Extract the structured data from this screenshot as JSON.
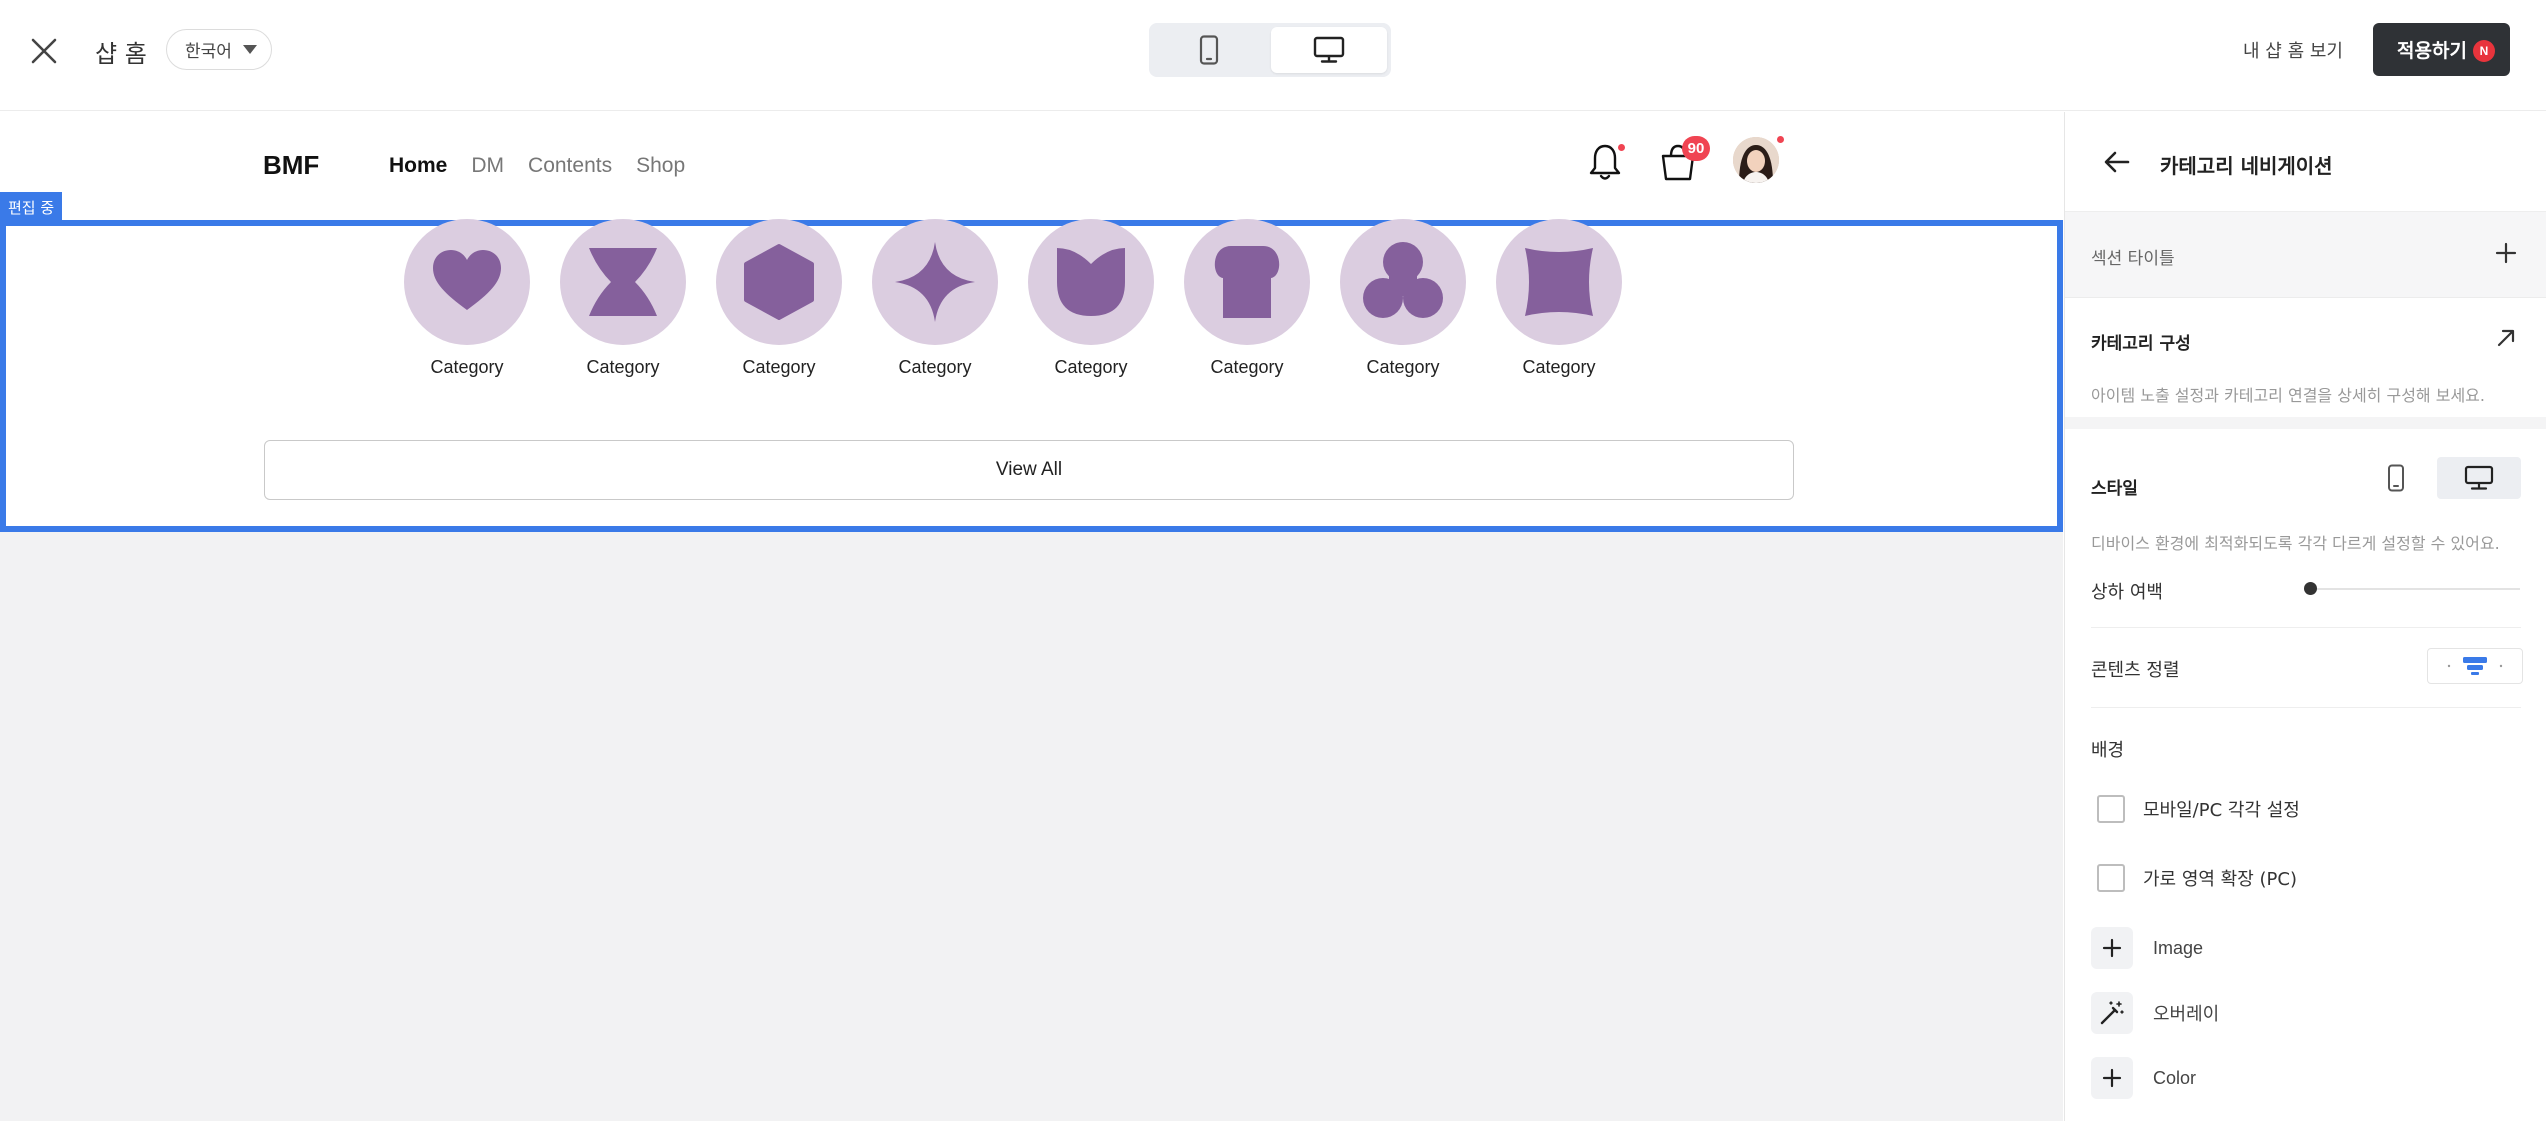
{
  "topbar": {
    "shop_home": "샵 홈",
    "language": "한국어",
    "view_my_shop": "내 샵 홈 보기",
    "apply": "적용하기",
    "apply_badge": "N"
  },
  "preview": {
    "brand": "BMF",
    "nav": [
      "Home",
      "DM",
      "Contents",
      "Shop"
    ],
    "cart_count": "90",
    "edit_tag": "편집 중",
    "categories": [
      {
        "label": "Category",
        "icon": "heart-shape"
      },
      {
        "label": "Category",
        "icon": "hourglass-shape"
      },
      {
        "label": "Category",
        "icon": "hexagon-shape"
      },
      {
        "label": "Category",
        "icon": "four-point-star-shape"
      },
      {
        "label": "Category",
        "icon": "tulip-shape"
      },
      {
        "label": "Category",
        "icon": "bread-shape"
      },
      {
        "label": "Category",
        "icon": "clover-shape"
      },
      {
        "label": "Category",
        "icon": "squircle-shape"
      }
    ],
    "view_all": "View All",
    "colors": {
      "category_bg": "#dbcde0",
      "category_fg": "#85609c",
      "edit_border": "#3a7ae8"
    }
  },
  "panel": {
    "title": "카테고리 네비게이션",
    "section_title": "섹션 타이틀",
    "category_compose": "카테고리 구성",
    "category_compose_desc": "아이템 노출 설정과 카테고리 연결을 상세히 구성해 보세요.",
    "style": "스타일",
    "style_desc": "디바이스 환경에 최적화되도록 각각 다르게 설정할 수 있어요.",
    "vertical_spacing": "상하 여백",
    "content_align": "콘텐츠 정렬",
    "background": "배경",
    "checkbox_separate": "모바일/PC 각각 설정",
    "checkbox_expand": "가로 영역 확장 (PC)",
    "add_image": "Image",
    "overlay": "오버레이",
    "add_color": "Color"
  }
}
